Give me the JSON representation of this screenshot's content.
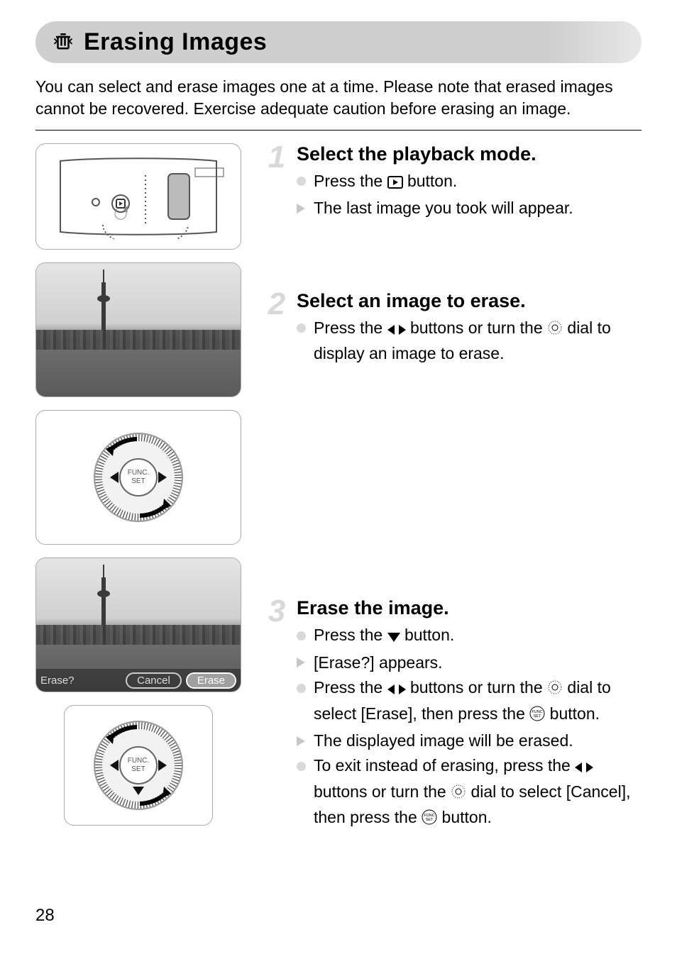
{
  "title": "Erasing Images",
  "intro": "You can select and erase images one at a time. Please note that erased images cannot be recovered. Exercise adequate caution before erasing an image.",
  "steps": {
    "s1": {
      "num": "1",
      "title": "Select the playback mode.",
      "items": [
        {
          "type": "dot",
          "text_a": "Press the ",
          "text_b": " button."
        },
        {
          "type": "arrow",
          "text": "The last image you took will appear."
        }
      ]
    },
    "s2": {
      "num": "2",
      "title": "Select an image to erase.",
      "items": [
        {
          "type": "dot",
          "text_a": "Press the ",
          "text_b": " buttons or turn the ",
          "text_c": " dial to display an image to erase."
        }
      ]
    },
    "s3": {
      "num": "3",
      "title": "Erase the image.",
      "items": [
        {
          "type": "dot",
          "text_a": "Press the ",
          "text_b": " button."
        },
        {
          "type": "arrow",
          "text": "[Erase?] appears."
        },
        {
          "type": "dot",
          "text_a": "Press the ",
          "text_b": " buttons or turn the ",
          "text_c": " dial to select [Erase], then press the ",
          "text_d": " button."
        },
        {
          "type": "arrow",
          "text": "The displayed image will be erased."
        },
        {
          "type": "dot",
          "text_a": "To exit instead of erasing, press the ",
          "text_b": " buttons or turn the ",
          "text_c": " dial to select [Cancel], then press the ",
          "text_d": " button."
        }
      ]
    }
  },
  "erase_prompt": {
    "label": "Erase?",
    "cancel": "Cancel",
    "erase": "Erase"
  },
  "page_number": "28"
}
